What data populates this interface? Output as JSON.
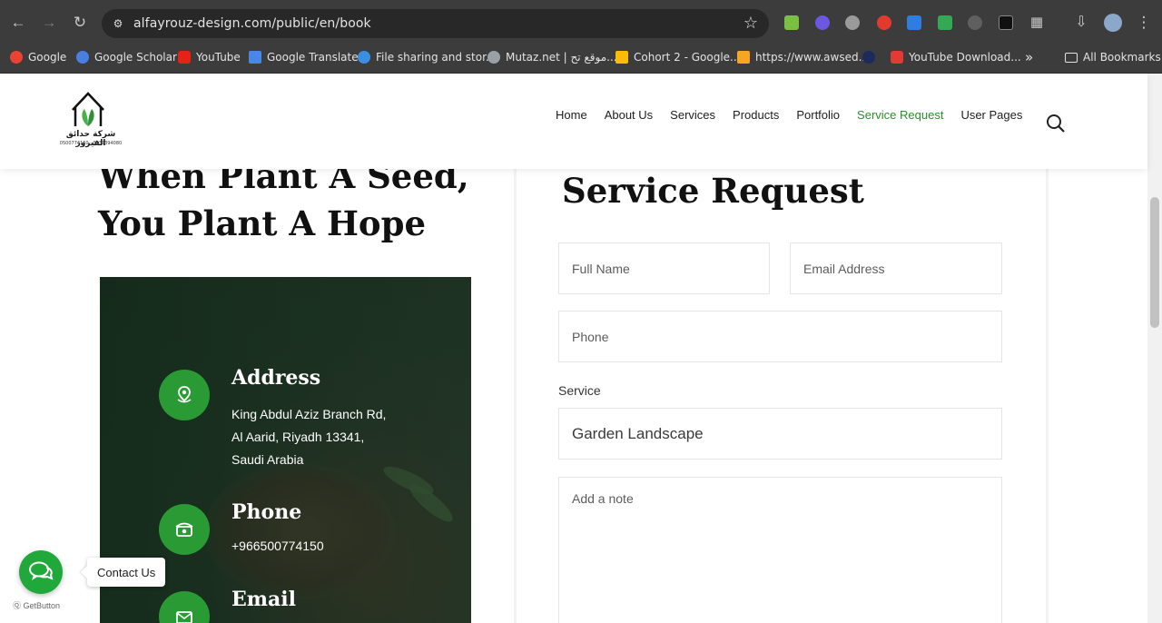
{
  "browser": {
    "url": "alfayrouz-design.com/public/en/book",
    "bookmarks": [
      {
        "label": "Google",
        "color": "#ea4335"
      },
      {
        "label": "Google Scholar",
        "color": "#4a7ee0"
      },
      {
        "label": "YouTube",
        "color": "#e62117"
      },
      {
        "label": "Google Translate",
        "color": "#4a86e8"
      },
      {
        "label": "File sharing and stor...",
        "color": "#3b8fe0"
      },
      {
        "label": "Mutaz.net | موقع تح...",
        "color": "#9aa0a6"
      },
      {
        "label": "Cohort 2 - Google...",
        "color": "#fbbc05"
      },
      {
        "label": "https://www.awsed...",
        "color": "#f5a623"
      },
      {
        "label": "",
        "color": "#1a2b5c"
      },
      {
        "label": "YouTube Download...",
        "color": "#e53935"
      }
    ],
    "more_bookmarks": "»",
    "all_bookmarks": "All Bookmarks"
  },
  "site": {
    "logo_name": "شركة حدائق الفيروز",
    "logo_sub": "0500774150 · 0537394080",
    "nav": [
      {
        "label": "Home",
        "active": false
      },
      {
        "label": "About Us",
        "active": false
      },
      {
        "label": "Services",
        "active": false
      },
      {
        "label": "Products",
        "active": false
      },
      {
        "label": "Portfolio",
        "active": false
      },
      {
        "label": "Service Request",
        "active": true
      },
      {
        "label": "User Pages",
        "active": false
      }
    ],
    "accent_color": "#2a9a35"
  },
  "hero": {
    "line1": "When Plant A Seed,",
    "line2": "You Plant A Hope"
  },
  "contact": {
    "address_title": "Address",
    "address_lines": [
      "King Abdul Aziz Branch Rd,",
      "Al Aarid, Riyadh 13341,",
      "Saudi Arabia"
    ],
    "phone_title": "Phone",
    "phone_value": "+966500774150",
    "email_title": "Email"
  },
  "form": {
    "title": "Service Request",
    "full_name_placeholder": "Full Name",
    "email_placeholder": "Email Address",
    "phone_placeholder": "Phone",
    "service_label": "Service",
    "service_value": "Garden Landscape",
    "note_placeholder": "Add a note"
  },
  "widget": {
    "contact_label": "Contact Us",
    "brand": "GetButton"
  }
}
